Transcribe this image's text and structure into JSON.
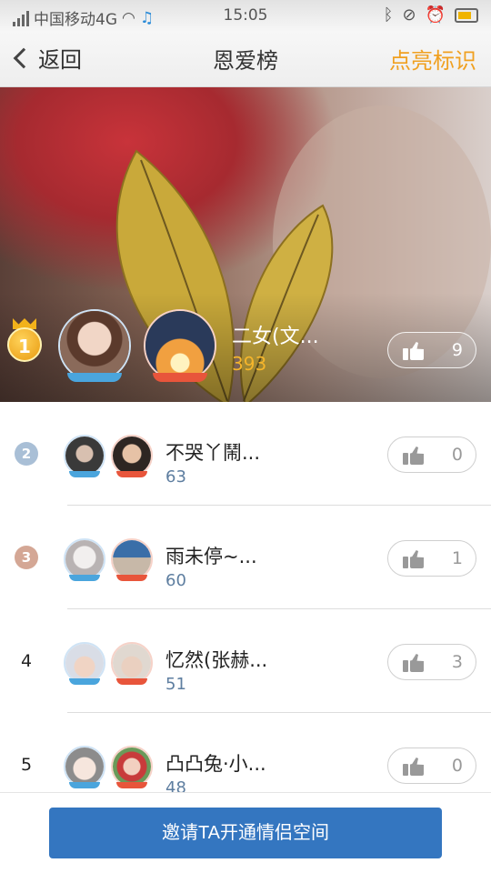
{
  "status_bar": {
    "carrier": "中国移动4G",
    "time": "15:05"
  },
  "nav": {
    "back_label": "返回",
    "title": "恩爱榜",
    "action_label": "点亮标识"
  },
  "top_couple": {
    "rank": "1",
    "name": "二女(文...",
    "score": "393",
    "likes": "9"
  },
  "list": [
    {
      "rank": "2",
      "name": "不哭丫鬧...",
      "score": "63",
      "likes": "0"
    },
    {
      "rank": "3",
      "name": "雨未停~...",
      "score": "60",
      "likes": "1"
    },
    {
      "rank": "4",
      "name": "忆然(张赫...",
      "score": "51",
      "likes": "3"
    },
    {
      "rank": "5",
      "name": "凸凸兔·小...",
      "score": "48",
      "likes": "0"
    }
  ],
  "invite_button": "邀请TA开通情侣空间",
  "colors": {
    "accent_orange": "#f0a020",
    "score_gold": "#f5b52b",
    "primary_blue": "#3476c0",
    "score_blue": "#5e7ea0"
  }
}
